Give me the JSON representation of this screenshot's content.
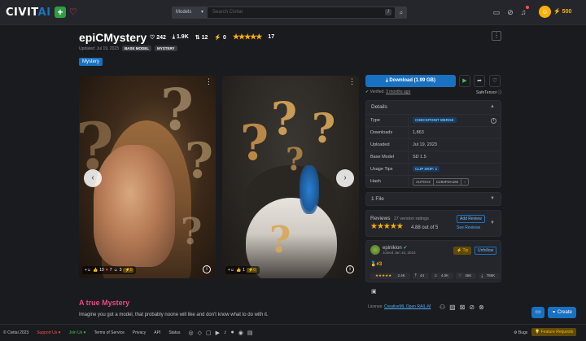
{
  "header": {
    "logo_main": "CIVIT",
    "logo_ai": "AI",
    "search_scope": "Models",
    "search_placeholder": "Search Civitai",
    "search_shortcut": "/",
    "buzz_amount": "500"
  },
  "model": {
    "title": "epiCMystery",
    "likes": "242",
    "downloads": "1.9K",
    "collects": "12",
    "tips": "0",
    "rating_count": "17",
    "updated": "Updated: Jul 19, 2023",
    "badge_type": "BASE MODEL",
    "badge_name": "MYSTERY",
    "tag": "Mystery"
  },
  "gallery": [
    {
      "reactions": [
        "10",
        "7",
        "3"
      ],
      "buzz": "0"
    },
    {
      "reactions": [
        "1"
      ],
      "buzz": "0"
    }
  ],
  "description": {
    "title": "A true Mystery",
    "text": "Imagine you got a model, that probably noone will like and don't know what to do with it."
  },
  "sidebar": {
    "download_label": "Download (1.99 GB)",
    "verified_label": "Verified:",
    "verified_time": "3 months ago",
    "safetensor": "SafeTensor",
    "details_title": "Details",
    "details": [
      {
        "key": "Type",
        "value": "CHECKPOINT MERGE"
      },
      {
        "key": "Downloads",
        "value": "1,863"
      },
      {
        "key": "Uploaded",
        "value": "Jul 19, 2023"
      },
      {
        "key": "Base Model",
        "value": "SD 1.5"
      },
      {
        "key": "Usage Tips",
        "value": "CLIP SKIP: 1"
      },
      {
        "key": "Hash",
        "value": ""
      }
    ],
    "hash_algo": "AUTOV2",
    "hash_value": "C293FDA182",
    "files_title": "1 File",
    "reviews_title": "Reviews",
    "reviews_count": "17 version ratings",
    "reviews_score": "4.88 out of 5",
    "add_review": "Add Review",
    "see_reviews": "See Reviews",
    "creator": {
      "name": "epinikion",
      "joined": "Joined Jan 10, 2023",
      "tip": "Tip",
      "unfollow": "Unfollow",
      "rank": "#3",
      "rating_count": "2.4K",
      "uploads": "44",
      "followers": "4.0K",
      "likes": "45K",
      "downloads": "785K"
    },
    "license_label": "License:",
    "license_text": "CreativeML Open RAIL-M"
  },
  "actions": {
    "create": "Create"
  },
  "footer": {
    "copyright": "© Civitai 2023",
    "support": "Support Us",
    "join": "Join Us",
    "tos": "Terms of Service",
    "privacy": "Privacy",
    "api": "API",
    "status": "Status",
    "bugs": "Bugs",
    "feature_requests": "Feature Requests"
  },
  "colors": {
    "accent": "#1971c2",
    "gold": "#fab005",
    "pink": "#e64980",
    "bg": "#1a1b1e"
  }
}
